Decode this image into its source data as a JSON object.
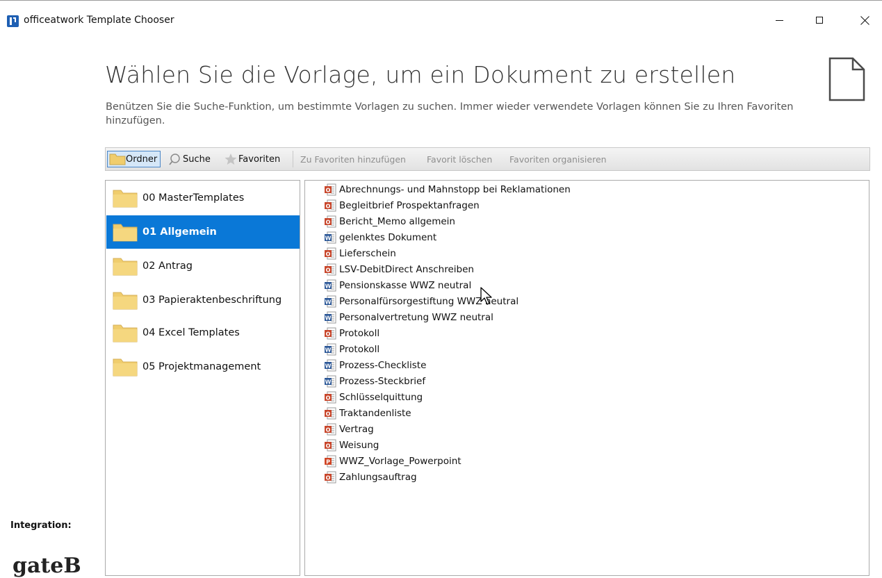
{
  "window": {
    "title": "officeatwork Template Chooser",
    "icon": "officeatwork-logo",
    "controls": [
      "minimize-icon",
      "maximize-icon",
      "close-icon"
    ]
  },
  "header": {
    "title": "Wählen Sie die Vorlage, um ein Dokument zu erstellen",
    "subtitle": "Benützen Sie die Suche-Funktion, um bestimmte Vorlagen zu suchen. Immer wieder verwendete Vorlagen können Sie zu Ihren Favoriten hinzufügen.",
    "icon": "blank-document-icon"
  },
  "toolbar": {
    "ordner": "Ordner",
    "suche": "Suche",
    "favoriten": "Favoriten",
    "add_favorite": "Zu Favoriten hinzufügen",
    "delete_favorite": "Favorit löschen",
    "organize_favorites": "Favoriten organisieren",
    "active_tab": "Ordner"
  },
  "folders": [
    {
      "label": "00 MasterTemplates",
      "selected": false
    },
    {
      "label": "01 Allgemein",
      "selected": true
    },
    {
      "label": "02 Antrag",
      "selected": false
    },
    {
      "label": "03 Papieraktenbeschriftung",
      "selected": false
    },
    {
      "label": "04 Excel Templates",
      "selected": false
    },
    {
      "label": "05 Projektmanagement",
      "selected": false
    }
  ],
  "templates": [
    {
      "label": "Abrechnungs- und Mahnstopp bei Reklamationen",
      "type": "officeatwork"
    },
    {
      "label": "Begleitbrief Prospektanfragen",
      "type": "officeatwork"
    },
    {
      "label": "Bericht_Memo allgemein",
      "type": "officeatwork"
    },
    {
      "label": "gelenktes Dokument",
      "type": "word"
    },
    {
      "label": "Lieferschein",
      "type": "officeatwork"
    },
    {
      "label": "LSV-DebitDirect Anschreiben",
      "type": "officeatwork"
    },
    {
      "label": "Pensionskasse WWZ neutral",
      "type": "word"
    },
    {
      "label": "Personalfürsorgestiftung WWZ neutral",
      "type": "word"
    },
    {
      "label": "Personalvertretung WWZ neutral",
      "type": "word"
    },
    {
      "label": "Protokoll",
      "type": "officeatwork"
    },
    {
      "label": "Protokoll",
      "type": "word"
    },
    {
      "label": "Prozess-Checkliste",
      "type": "word"
    },
    {
      "label": "Prozess-Steckbrief",
      "type": "word"
    },
    {
      "label": "Schlüsselquittung",
      "type": "officeatwork"
    },
    {
      "label": "Traktandenliste",
      "type": "officeatwork"
    },
    {
      "label": "Vertrag",
      "type": "officeatwork"
    },
    {
      "label": "Weisung",
      "type": "officeatwork"
    },
    {
      "label": "WWZ_Vorlage_Powerpoint",
      "type": "powerpoint"
    },
    {
      "label": "Zahlungsauftrag",
      "type": "officeatwork"
    }
  ],
  "footer": {
    "integration_label": "Integration:",
    "logo_text": "gateB"
  },
  "colors": {
    "selection": "#0a78d7",
    "folder": "#f0cd6d",
    "officeatwork": "#c8462b",
    "word": "#2b5797",
    "powerpoint": "#d04525"
  }
}
